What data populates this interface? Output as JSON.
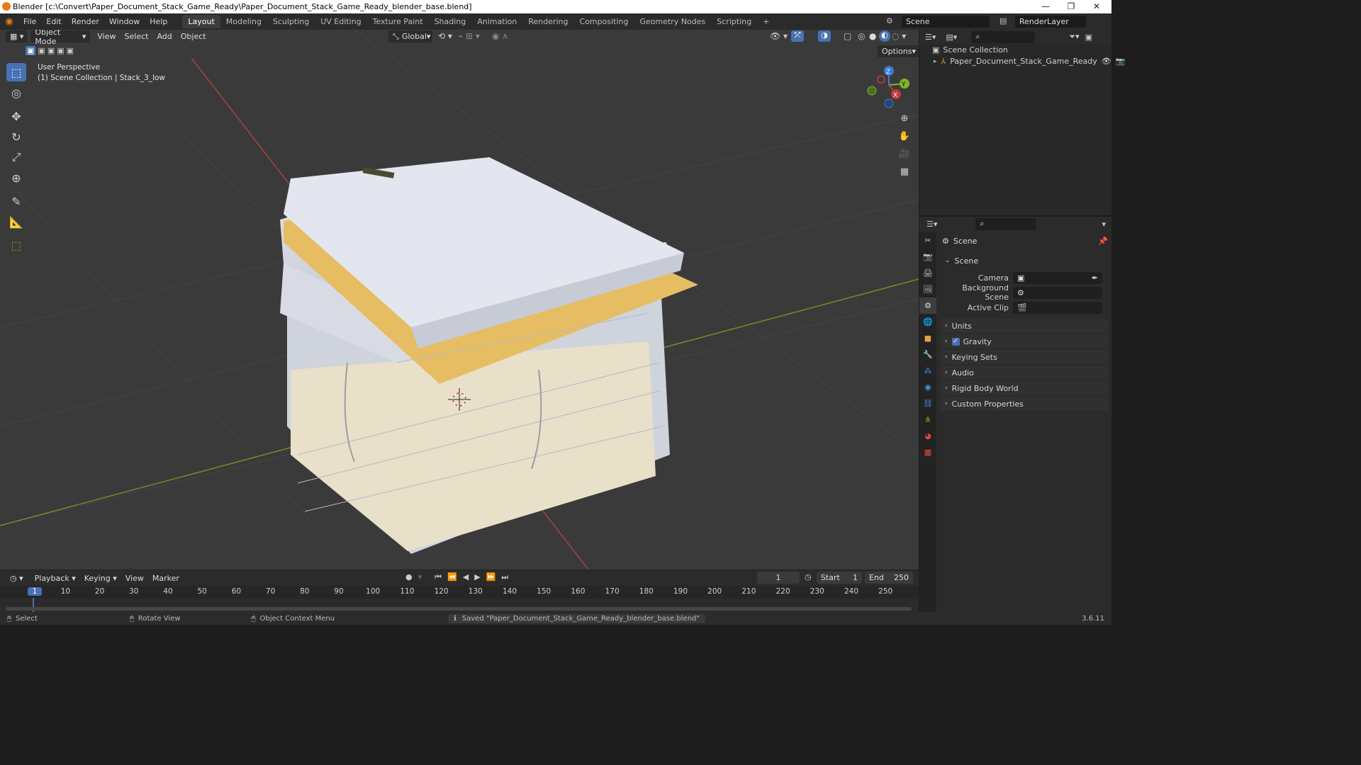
{
  "window": {
    "title": "Blender [c:\\Convert\\Paper_Document_Stack_Game_Ready\\Paper_Document_Stack_Game_Ready_blender_base.blend]",
    "minimize": "—",
    "maximize": "❐",
    "close": "✕"
  },
  "menu": [
    "File",
    "Edit",
    "Render",
    "Window",
    "Help"
  ],
  "workspaces": [
    "Layout",
    "Modeling",
    "Sculpting",
    "UV Editing",
    "Texture Paint",
    "Shading",
    "Animation",
    "Rendering",
    "Compositing",
    "Geometry Nodes",
    "Scripting",
    "+"
  ],
  "scene_field": "Scene",
  "renderlayer_field": "RenderLayer",
  "viewport": {
    "mode": "Object Mode",
    "menus": [
      "View",
      "Select",
      "Add",
      "Object"
    ],
    "orientation": "Global",
    "options": "Options",
    "overlay_line1": "User Perspective",
    "overlay_line2": "(1) Scene Collection | Stack_3_low",
    "gizmo_axes": {
      "z": "Z",
      "y": "Y",
      "x": "X"
    }
  },
  "outliner": {
    "root": "Scene Collection",
    "items": [
      "Paper_Document_Stack_Game_Ready"
    ]
  },
  "properties": {
    "header": "Scene",
    "section": "Scene",
    "fields": [
      {
        "label": "Camera",
        "value": ""
      },
      {
        "label": "Background Scene",
        "value": ""
      },
      {
        "label": "Active Clip",
        "value": ""
      }
    ],
    "panels": [
      "Units",
      "Gravity",
      "Keying Sets",
      "Audio",
      "Rigid Body World",
      "Custom Properties"
    ],
    "gravity_checked": true
  },
  "timeline": {
    "menus": [
      "Playback",
      "Keying",
      "View",
      "Marker"
    ],
    "current_frame": "1",
    "start_label": "Start",
    "start": "1",
    "end_label": "End",
    "end": "250",
    "ticks": [
      "1",
      "10",
      "20",
      "30",
      "40",
      "50",
      "60",
      "70",
      "80",
      "90",
      "100",
      "110",
      "120",
      "130",
      "140",
      "150",
      "160",
      "170",
      "180",
      "190",
      "200",
      "210",
      "220",
      "230",
      "240",
      "250"
    ]
  },
  "status": {
    "select": "Select",
    "rotate": "Rotate View",
    "context": "Object Context Menu",
    "message": "Saved \"Paper_Document_Stack_Game_Ready_blender_base.blend\"",
    "version": "3.6.11"
  },
  "colors": {
    "accent": "#4772b3",
    "x_axis": "#c33a3a",
    "y_axis": "#7fb32a",
    "z_axis": "#3b7cd6"
  }
}
